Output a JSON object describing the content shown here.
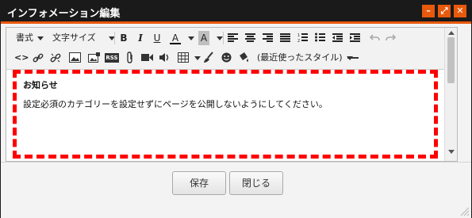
{
  "window": {
    "title": "インフォメーション編集"
  },
  "titlebar_buttons": {
    "minimize_icon": "–",
    "maximize_icon": "⤢",
    "close_icon": "✕"
  },
  "toolbar": {
    "format_label": "書式",
    "fontsize_label": "文字サイズ",
    "bold": "B",
    "italic": "I",
    "underline": "U",
    "text_color": "A",
    "bg_color": "A",
    "style_label": "(最近使ったスタイル)",
    "rss": "RSS"
  },
  "content": {
    "heading": "お知らせ",
    "paragraph": "設定必須のカテゴリーを設定せずにページを公開しないようにしてください。"
  },
  "buttons": {
    "save": "保存",
    "close": "閉じる"
  },
  "colors": {
    "accent": "#e8590c",
    "titlebar": "#1a1a1a",
    "dashed_border": "#ff0000"
  }
}
